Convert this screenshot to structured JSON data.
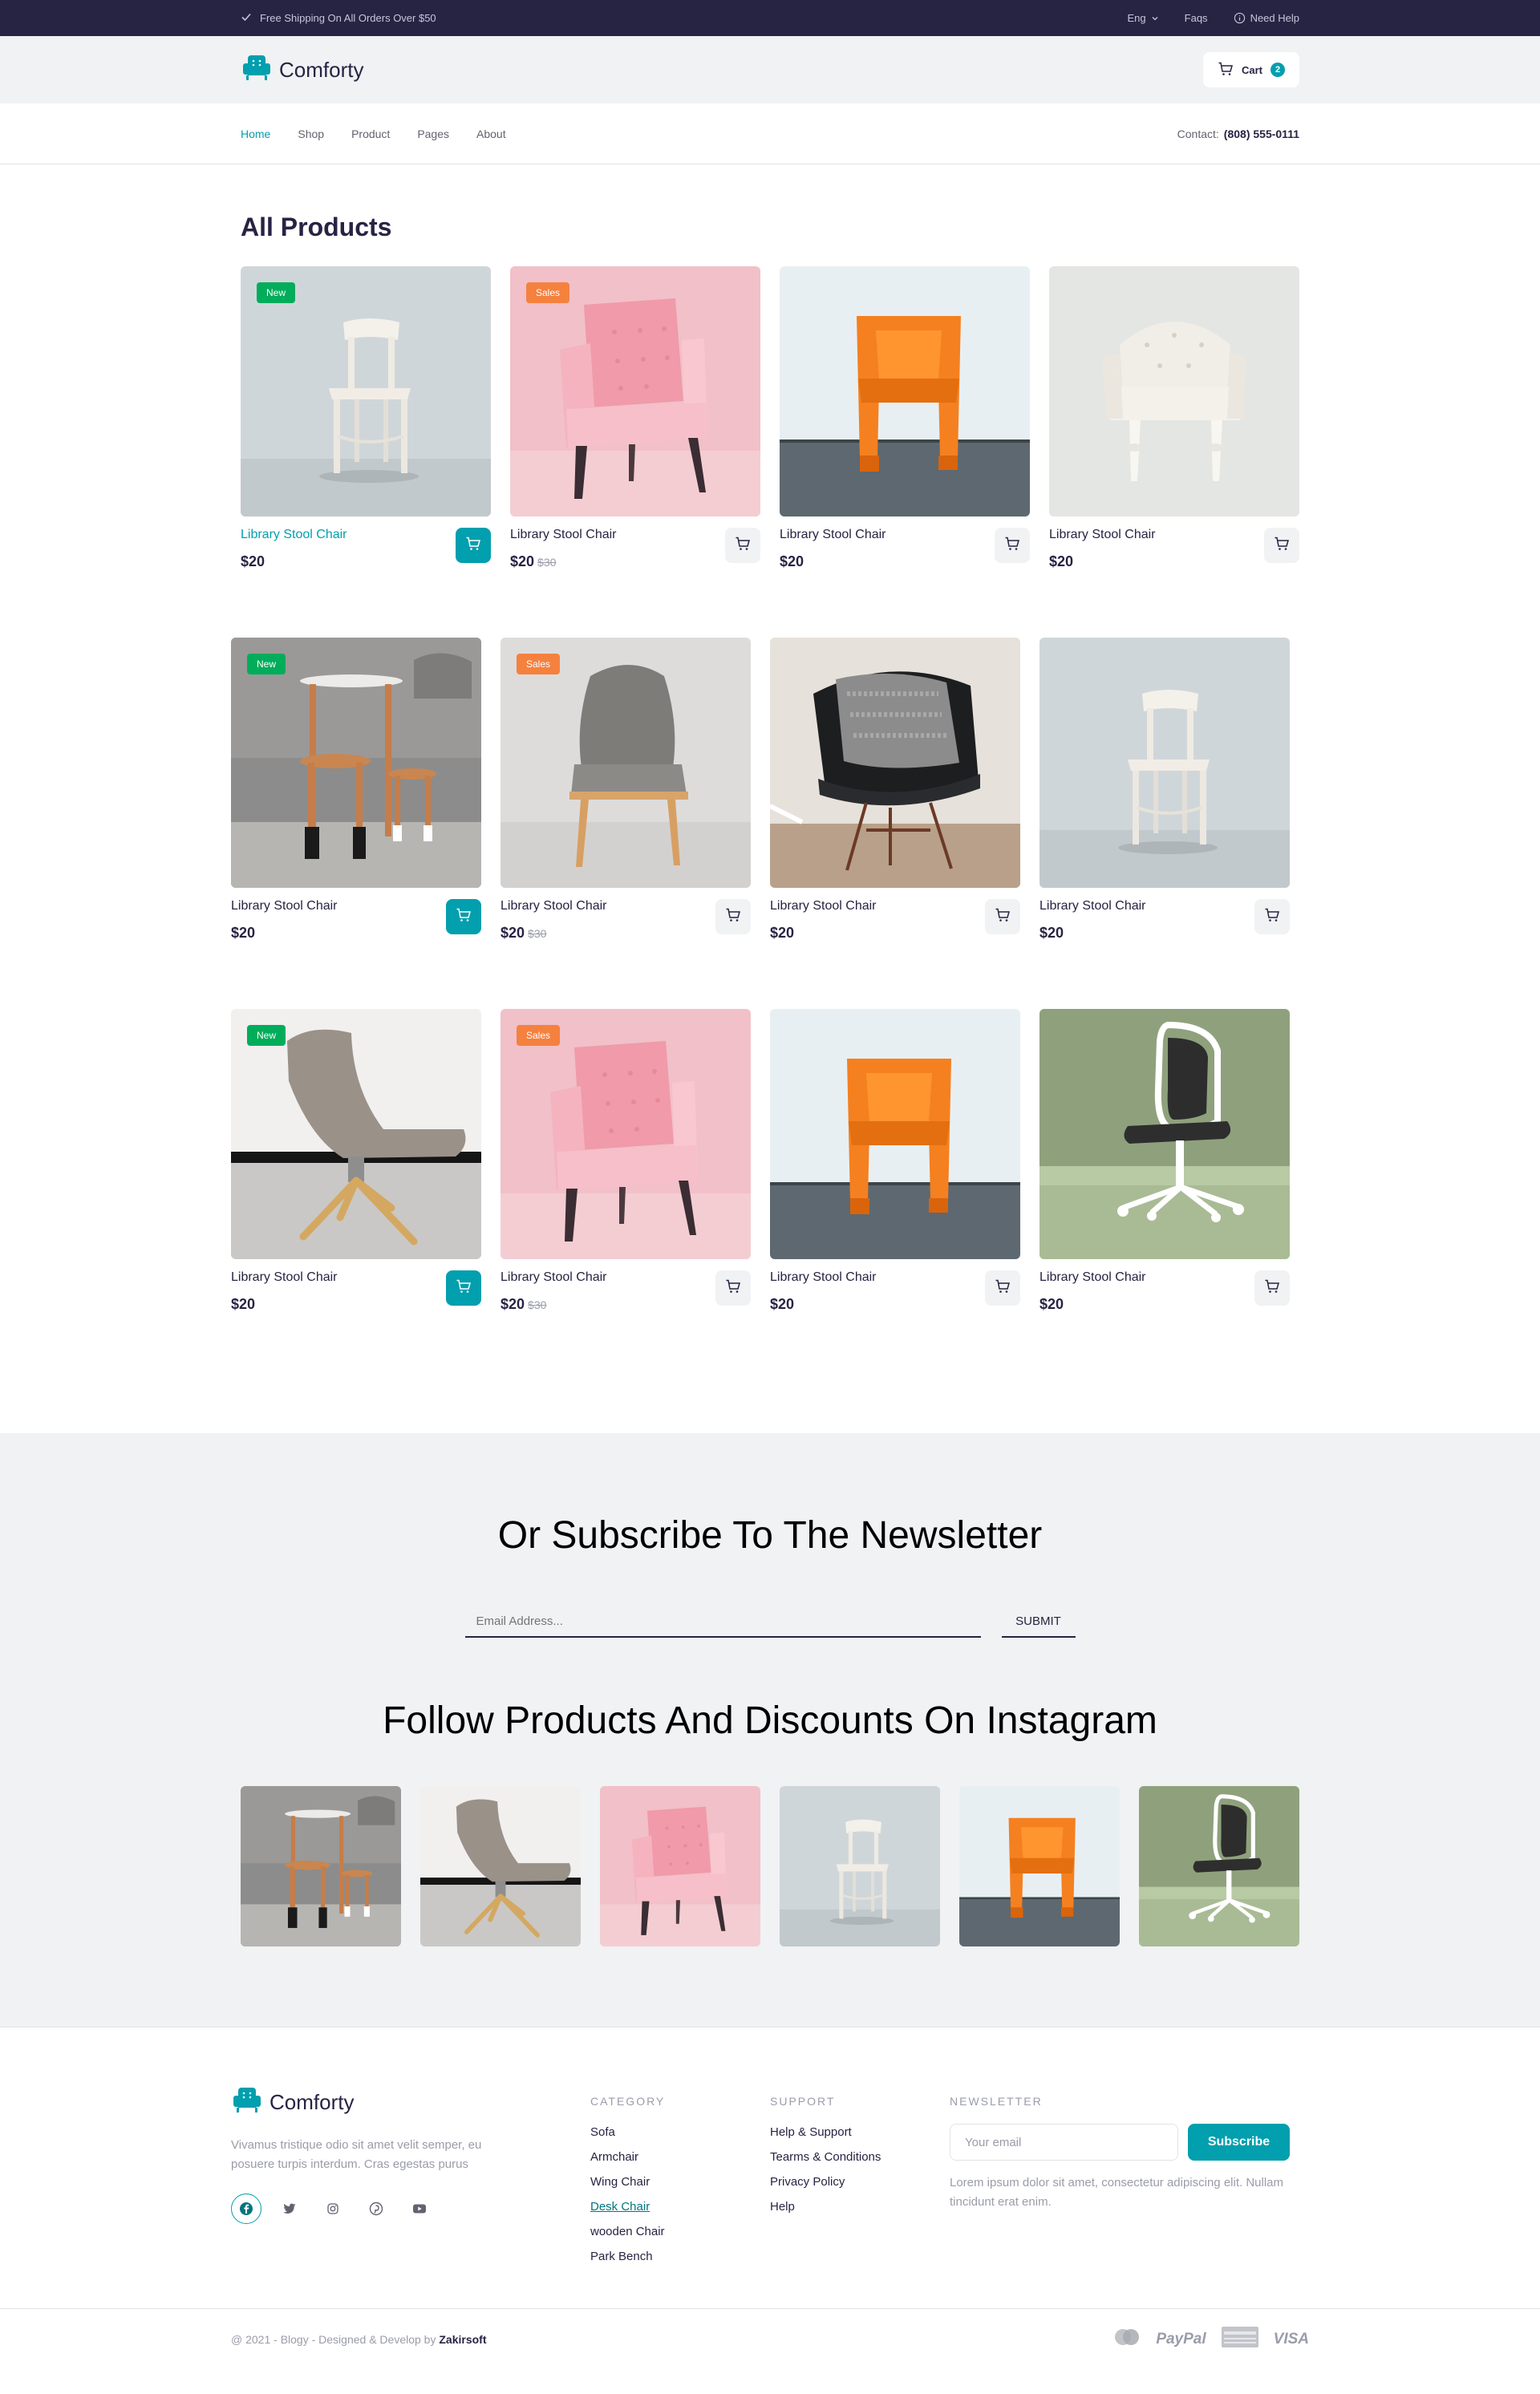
{
  "topbar": {
    "shipping": "Free Shipping On All Orders Over $50",
    "lang": "Eng",
    "faqs": "Faqs",
    "help": "Need Help"
  },
  "header": {
    "brand": "Comforty",
    "cart_label": "Cart",
    "cart_count": "2"
  },
  "nav": {
    "items": [
      "Home",
      "Shop",
      "Product",
      "Pages",
      "About"
    ],
    "active": "Home",
    "contact_label": "Contact:",
    "contact_phone": "(808) 555-0111"
  },
  "products": {
    "title": "All Products",
    "rows": [
      [
        {
          "name": "Library Stool Chair",
          "price": "$20",
          "old": "",
          "badge": "New",
          "img": "white-chair"
        },
        {
          "name": "Library Stool Chair",
          "price": "$20",
          "old": "$30",
          "badge": "Sales",
          "img": "pink-armchair"
        },
        {
          "name": "Library Stool Chair",
          "price": "$20",
          "old": "",
          "badge": "",
          "img": "orange-chair"
        },
        {
          "name": "Library Stool Chair",
          "price": "$20",
          "old": "",
          "badge": "",
          "img": "tufted-chair"
        }
      ],
      [
        {
          "name": "Library Stool Chair",
          "price": "$20",
          "old": "",
          "badge": "New",
          "img": "stools"
        },
        {
          "name": "Library Stool Chair",
          "price": "$20",
          "old": "$30",
          "badge": "Sales",
          "img": "gray-wingchair"
        },
        {
          "name": "Library Stool Chair",
          "price": "$20",
          "old": "",
          "badge": "",
          "img": "black-chair"
        },
        {
          "name": "Library Stool Chair",
          "price": "$20",
          "old": "",
          "badge": "",
          "img": "white-chair"
        }
      ],
      [
        {
          "name": "Library Stool Chair",
          "price": "$20",
          "old": "",
          "badge": "New",
          "img": "lounge-chair"
        },
        {
          "name": "Library Stool Chair",
          "price": "$20",
          "old": "$30",
          "badge": "Sales",
          "img": "pink-armchair"
        },
        {
          "name": "Library Stool Chair",
          "price": "$20",
          "old": "",
          "badge": "",
          "img": "orange-chair"
        },
        {
          "name": "Library Stool Chair",
          "price": "$20",
          "old": "",
          "badge": "",
          "img": "desk-chair"
        }
      ]
    ]
  },
  "newsletter": {
    "title": "Or Subscribe To The Newsletter",
    "placeholder": "Email Address...",
    "submit": "SUBMIT",
    "insta_title": "Follow Products And Discounts On Instagram",
    "insta_images": [
      "stools",
      "lounge-chair",
      "pink-armchair",
      "white-chair",
      "orange-chair",
      "desk-chair"
    ]
  },
  "footer": {
    "brand": "Comforty",
    "desc": "Vivamus tristique odio sit amet velit semper, eu posuere turpis interdum. Cras egestas purus",
    "category_title": "CATEGORY",
    "categories": [
      "Sofa",
      "Armchair",
      "Wing Chair",
      "Desk Chair",
      "wooden Chair",
      "Park Bench"
    ],
    "support_title": "SUPPORT",
    "support": [
      "Help & Support",
      "Tearms & Conditions",
      "Privacy Policy",
      "Help"
    ],
    "newsletter_title": "NEWSLETTER",
    "email_placeholder": "Your email",
    "subscribe": "Subscribe",
    "newsletter_text": "Lorem ipsum dolor sit amet, consectetur adipiscing elit. Nullam tincidunt erat enim.",
    "copyright": "@ 2021 - Blogy - Designed & Develop by",
    "copyright_author": "Zakirsoft",
    "payments": [
      "PayPal",
      "VISA"
    ]
  },
  "colors": {
    "accent": "#029fae",
    "dark": "#272343",
    "new_badge": "#01ad5a",
    "sale_badge": "#f5813f"
  }
}
